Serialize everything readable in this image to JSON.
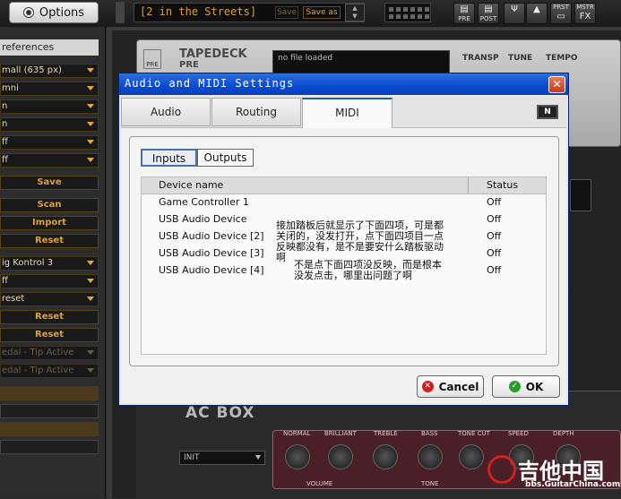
{
  "topbar": {
    "options_label": "Options",
    "preset_name": "[2 in the Streets]",
    "save_label": "Save",
    "save_as_label": "Save as",
    "pre_label": "PRE",
    "post_label": "POST",
    "prst_label": "PRST",
    "mstr_label": "MSTR",
    "fx_label": "FX"
  },
  "left_panel": {
    "section_header": "references",
    "dropdowns_top": [
      "mall (635 px)",
      "mni",
      "n",
      "n",
      "ff",
      "ff"
    ],
    "save_label": "Save",
    "scan_label": "Scan",
    "import_label": "Import",
    "reset1_label": "Reset",
    "dropdowns_mid": [
      "ig Kontrol 3",
      "ff",
      "reset"
    ],
    "reset2_label": "Reset",
    "reset3_label": "Reset",
    "tip_active_1": "edal - Tip Active",
    "tip_active_2": "edal - Tip Active"
  },
  "background": {
    "tapedeck_pre": "PRE",
    "tapedeck_title": "TAPEDECK",
    "tapedeck_subtitle": "PRE",
    "file_status": "no file loaded",
    "transp_label": "TRANSP",
    "tune_label": "TUNE",
    "tempo_label": "TEMPO",
    "acbox_title": "AC BOX",
    "acbox_preset": "INIT",
    "knob_labels": [
      "NORMAL",
      "BRILLIANT",
      "TREBLE",
      "BASS",
      "TONE CUT",
      "SPEED",
      "DEPTH"
    ],
    "volume_label": "VOLUME",
    "tone_label": "TONE",
    "watermark_main": "吉他中国",
    "watermark_url": "bbs.GuitarChina.com"
  },
  "dialog": {
    "title": "Audio and MIDI Settings",
    "close_label": "✕",
    "tabs": [
      {
        "label": "Audio",
        "active": false
      },
      {
        "label": "Routing",
        "active": false
      },
      {
        "label": "MIDI",
        "active": true
      }
    ],
    "logo_text": "N",
    "inputs_label": "Inputs",
    "outputs_label": "Outputs",
    "columns": {
      "name": "Device name",
      "status": "Status"
    },
    "devices": [
      {
        "name": "Game Controller 1",
        "status": "Off"
      },
      {
        "name": "USB Audio Device",
        "status": "Off"
      },
      {
        "name": "USB Audio Device [2]",
        "status": "Off"
      },
      {
        "name": "USB Audio Device [3]",
        "status": "Off"
      },
      {
        "name": "USB Audio Device [4]",
        "status": "Off"
      }
    ],
    "note_lines": [
      "接加踏板后就显示了下面四项，可是都",
      "关闭的，没发打开，点下面四项目一点",
      "反映都没有，是不是要安什么踏板驱动",
      "啊"
    ],
    "note2_lines": [
      "不是点下面四项没反映，而是根本",
      "没发点击，哪里出问题了啊"
    ],
    "cancel_label": "Cancel",
    "ok_label": "OK"
  }
}
